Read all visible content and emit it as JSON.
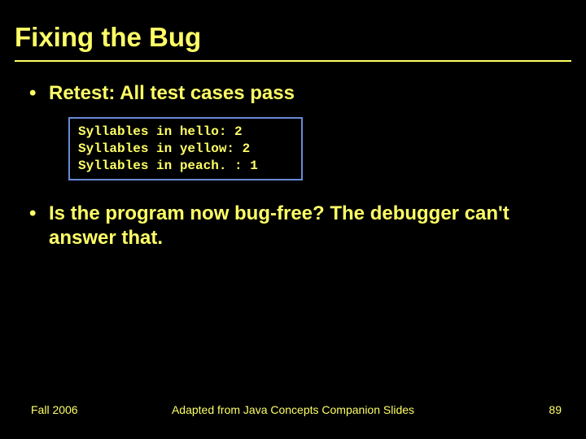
{
  "title": "Fixing the Bug",
  "bullets": {
    "b1": "Retest: All test cases pass",
    "b2": "Is the program now bug-free? The debugger can't answer that."
  },
  "code": {
    "line1": "Syllables in hello: 2",
    "line2": "Syllables in yellow: 2",
    "line3": "Syllables in peach. : 1"
  },
  "footer": {
    "left": "Fall 2006",
    "center": "Adapted from Java Concepts Companion Slides",
    "page": "89"
  }
}
